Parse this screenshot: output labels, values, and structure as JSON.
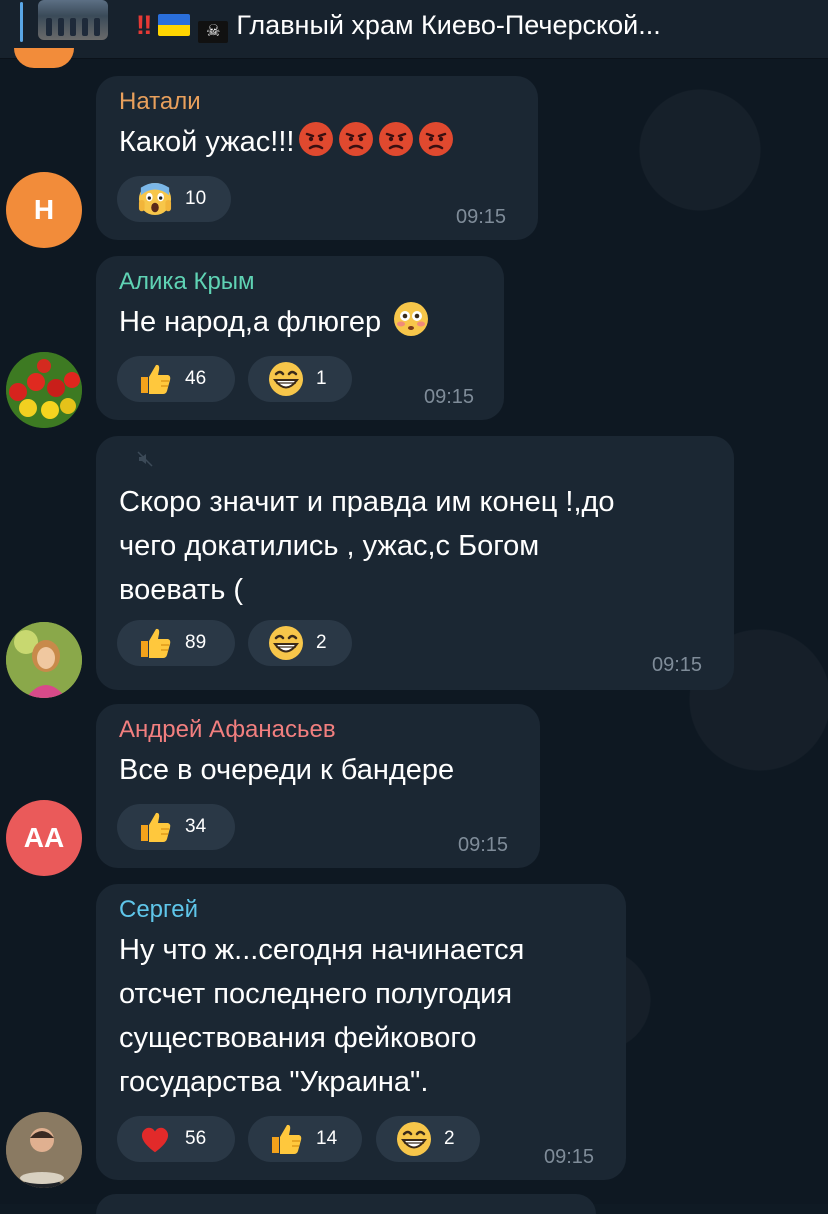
{
  "pinned": {
    "title": "Главный храм Киево-Печерской..."
  },
  "messages": [
    {
      "author": "Натали",
      "author_color": "#e9a05c",
      "text": "Какой ужас!!!",
      "time": "09:15",
      "avatar_initials": "Н",
      "reactions": [
        {
          "emoji": "scream",
          "count": "10"
        }
      ]
    },
    {
      "author": "Алика Крым",
      "author_color": "#5fd3b4",
      "text": "Не народ,а флюгер",
      "time": "09:15",
      "reactions": [
        {
          "emoji": "thumbs-up",
          "count": "46"
        },
        {
          "emoji": "grin",
          "count": "1"
        }
      ]
    },
    {
      "author": "",
      "text": "Скоро значит и правда им конец !,до\nчего докатились , ужас,с Богом\nвоевать (",
      "time": "09:15",
      "reactions": [
        {
          "emoji": "thumbs-up",
          "count": "89"
        },
        {
          "emoji": "grin",
          "count": "2"
        }
      ]
    },
    {
      "author": "Андрей Афанасьев",
      "author_color": "#f27f7f",
      "text": "Все в очереди к бандере",
      "time": "09:15",
      "avatar_initials": "АА",
      "reactions": [
        {
          "emoji": "thumbs-up",
          "count": "34"
        }
      ]
    },
    {
      "author": "Сергей",
      "author_color": "#5fc6ea",
      "text": "Ну что ж...сегодня начинается\nотсчет  последнего полугодия\nсуществования фейкового\nгосударства \"Украина\".",
      "time": "09:15",
      "reactions": [
        {
          "emoji": "heart",
          "count": "56"
        },
        {
          "emoji": "thumbs-up",
          "count": "14"
        },
        {
          "emoji": "grin",
          "count": "2"
        }
      ]
    }
  ]
}
